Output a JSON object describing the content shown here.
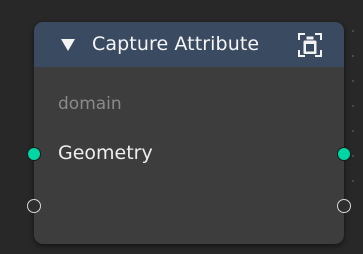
{
  "node": {
    "title": "Capture Attribute",
    "header_icon": "capture-attribute-icon",
    "collapse_icon": "triangle-down-icon",
    "domain_label": "domain",
    "geometry_label": "Geometry",
    "colors": {
      "header": "#3a4a61",
      "body": "#3d3d3d",
      "geometry_socket": "#00d6a3",
      "background": "#282828"
    }
  }
}
